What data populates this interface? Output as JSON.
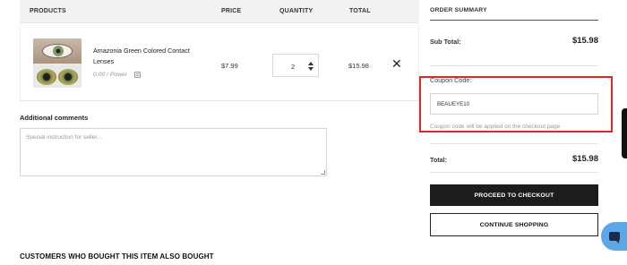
{
  "cart": {
    "headers": {
      "products": "PRODUCTS",
      "price": "PRICE",
      "quantity": "QUANTITY",
      "total": "TOTAL"
    },
    "item": {
      "name": "Amazonia Green Colored Contact Lenses",
      "meta": "0.00 / Power",
      "price": "$7.99",
      "quantity": "2",
      "line_total": "$15.98",
      "remove_glyph": "✕"
    }
  },
  "comments": {
    "label": "Additional comments",
    "placeholder": "Special instruction for seller..."
  },
  "recommendations": {
    "heading": "CUSTOMERS WHO BOUGHT THIS ITEM ALSO BOUGHT"
  },
  "summary": {
    "title": "ORDER SUMMARY",
    "subtotal_label": "Sub Total:",
    "subtotal_value": "$15.98",
    "coupon_label": "Coupon Code:",
    "coupon_value": "BEAUEYE10",
    "coupon_note": "Coupon code will be applied on the checkout page",
    "total_label": "Total:",
    "total_value": "$15.98",
    "checkout_button": "PROCEED TO CHECKOUT",
    "continue_button": "CONTINUE SHOPPING"
  },
  "colors": {
    "highlight_border": "#e32626",
    "checkout_bg": "#1c1c1c",
    "chat_bg": "#5ea7e6"
  },
  "icons": {
    "remove": "close-icon",
    "edit": "edit-note-icon",
    "stepper": "quantity-stepper-icon",
    "chat": "chat-icon"
  }
}
